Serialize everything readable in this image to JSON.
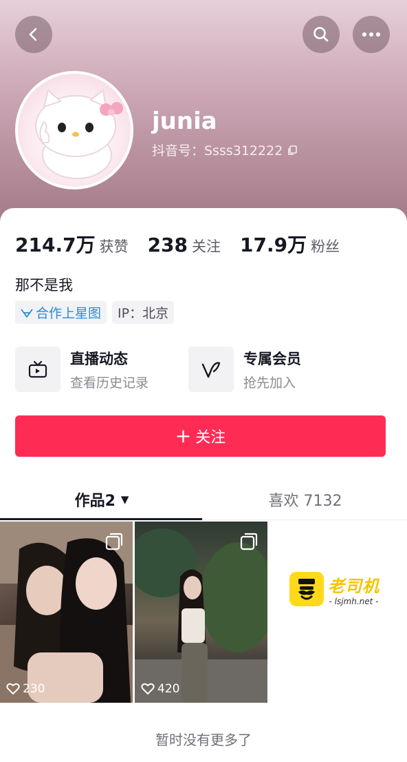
{
  "profile": {
    "username": "junia",
    "douyin_id": "抖音号：Ssss312222",
    "bio": "那不是我"
  },
  "stats": [
    {
      "value": "214.7万",
      "label": "获赞"
    },
    {
      "value": "238",
      "label": "关注"
    },
    {
      "value": "17.9万",
      "label": "粉丝"
    }
  ],
  "tags": {
    "xingtu": "合作上星图",
    "ip": "IP：北京"
  },
  "features": [
    {
      "title": "直播动态",
      "subtitle": "查看历史记录",
      "icon": "tv-icon"
    },
    {
      "title": "专属会员",
      "subtitle": "抢先加入",
      "icon": "v-icon"
    }
  ],
  "follow_button": {
    "plus": "+",
    "label": "关注"
  },
  "tabs": {
    "works": "作品2",
    "works_caret": "▼",
    "likes": "喜欢 7132"
  },
  "videos": [
    {
      "likes": "230"
    },
    {
      "likes": "420"
    }
  ],
  "watermark": {
    "brand": "老司机",
    "url": "- lsjmh.net -"
  },
  "footer": {
    "no_more": "暂时没有更多了"
  },
  "colors": {
    "follow": "#fe2c55",
    "header_top": "#e6cfd9",
    "header_bottom": "#a37886",
    "xingtu_blue": "#2a8bd8"
  }
}
